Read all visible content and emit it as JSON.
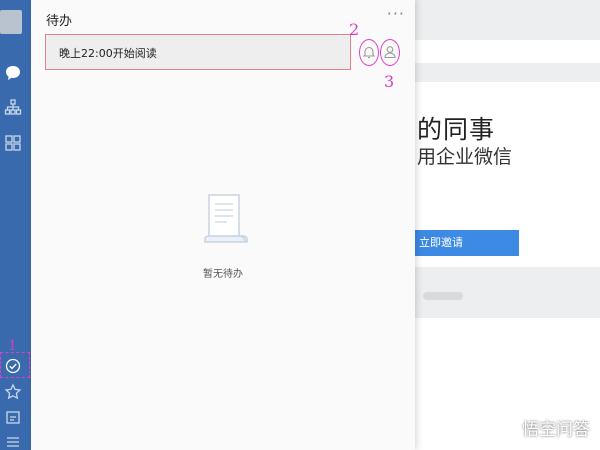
{
  "todo": {
    "title": "待办",
    "more_label": "···",
    "task_input_value": "晚上22:00开始阅读",
    "empty_text": "暂无待办"
  },
  "annotations": {
    "n1": "1",
    "n2": "2",
    "n3": "3"
  },
  "background": {
    "headline": "的同事",
    "subline": "用企业微信",
    "invite_label": "立即邀请"
  },
  "watermark": "悟空问答",
  "colors": {
    "rail": "#3a6aae",
    "annotation": "#d43cc4",
    "task_border": "#e5808f",
    "invite_button": "#3c8ae4"
  },
  "icons": {
    "rail": [
      "avatar",
      "chat-icon",
      "org-icon",
      "apps-icon",
      "todo-icon",
      "star-icon",
      "doc-icon",
      "menu-icon"
    ],
    "toolbar": [
      "bell-icon",
      "person-icon"
    ],
    "empty": "document-icon"
  }
}
